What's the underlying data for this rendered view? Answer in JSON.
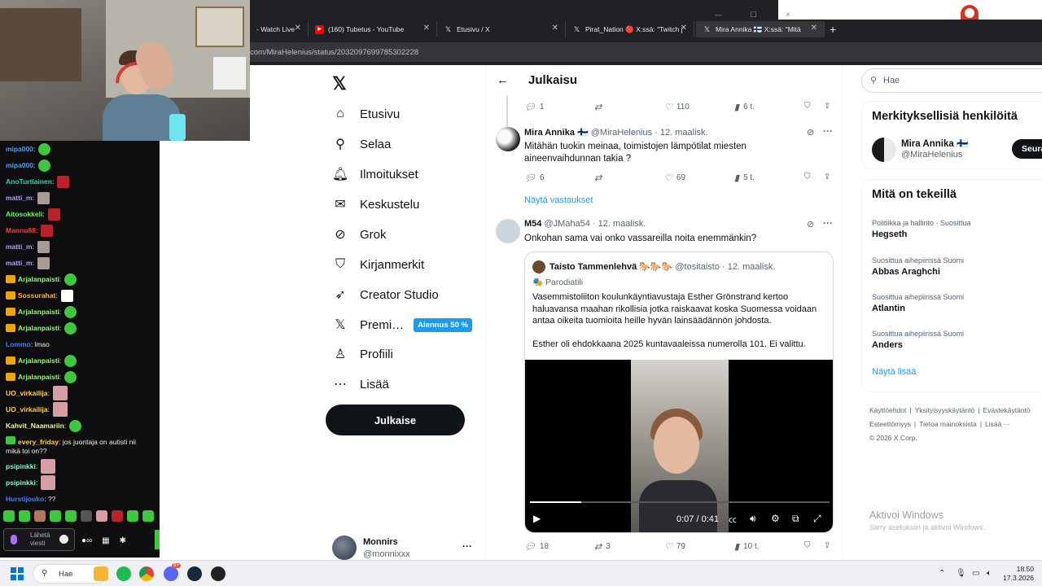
{
  "browser": {
    "tabs": [
      {
        "label": "- Watch Live",
        "active": false
      },
      {
        "label": "(160) Tubetus - YouTube",
        "active": false
      },
      {
        "label": "Etusivu / X",
        "active": false
      },
      {
        "label": "Pirat_Nation 🔴 X:ssä: \"Twitch j",
        "active": false
      },
      {
        "label": "Mira Annika 🇫🇮 X:ssä: \"Mitä",
        "active": true
      }
    ],
    "url": "com/MiraHelenius/status/2032097699785302228"
  },
  "chat": {
    "messages": [
      {
        "user": "mipa000",
        "color": "#4a9eff",
        "body": ":",
        "emote": "green",
        "crown": false
      },
      {
        "user": "mipa000",
        "color": "#4a9eff",
        "body": ":",
        "emote": "green",
        "crown": false
      },
      {
        "user": "AnoTurtiainen",
        "color": "#38d0b5",
        "body": ":",
        "emote": "red",
        "crown": false
      },
      {
        "user": "matti_m",
        "color": "#a7a3ff",
        "body": ":",
        "emote": "cat",
        "crown": false
      },
      {
        "user": "Aitosokkeli",
        "color": "#5cff5c",
        "body": ":",
        "emote": "red",
        "crown": false
      },
      {
        "user": "Mannu88",
        "color": "#ff3b3b",
        "body": ":",
        "emote": "red",
        "crown": false
      },
      {
        "user": "matti_m",
        "color": "#a7a3ff",
        "body": ":",
        "emote": "cat",
        "crown": false
      },
      {
        "user": "matti_m",
        "color": "#a7a3ff",
        "body": ":",
        "emote": "cat",
        "crown": false
      },
      {
        "user": "Arjalanpaisti",
        "color": "#8fff6b",
        "body": ":",
        "emote": "green",
        "crown": true
      },
      {
        "user": "Sossurahat",
        "color": "#ffb347",
        "body": ":",
        "emote": "mute",
        "crown": true
      },
      {
        "user": "Arjalanpaisti",
        "color": "#8fff6b",
        "body": ":",
        "emote": "green",
        "crown": true
      },
      {
        "user": "Arjalanpaisti",
        "color": "#8fff6b",
        "body": ":",
        "emote": "green",
        "crown": true
      },
      {
        "user": "Lommo",
        "color": "#4a7bff",
        "body": ": lmao",
        "emote": "",
        "crown": false
      },
      {
        "user": "Arjalanpaisti",
        "color": "#8fff6b",
        "body": ":",
        "emote": "green",
        "crown": true
      },
      {
        "user": "Arjalanpaisti",
        "color": "#8fff6b",
        "body": ":",
        "emote": "green",
        "crown": true
      },
      {
        "user": "UO_virkailija",
        "color": "#ffd24a",
        "body": ":",
        "emote": "pink",
        "crown": false
      },
      {
        "user": "UO_virkailija",
        "color": "#ffd24a",
        "body": ":",
        "emote": "pink",
        "crown": false
      },
      {
        "user": "Kahvit_Naamariin",
        "color": "#e8f7a0",
        "body": ":",
        "emote": "green",
        "crown": false
      }
    ],
    "long_message": {
      "user": "every_friday",
      "color": "#ffd24a",
      "line1": ": jos juontaja on autisti nii",
      "line2": "mikä toi on??"
    },
    "after": [
      {
        "user": "psipinkki",
        "color": "#7bffcf",
        "body": ":",
        "emote": "pink"
      },
      {
        "user": "psipinkki",
        "color": "#7bffcf",
        "body": ":",
        "emote": "pink"
      },
      {
        "user": "Hurstijouko",
        "color": "#4a7bff",
        "body": ": ??",
        "emote": ""
      }
    ],
    "input_placeholder_1": "Lähetä",
    "input_placeholder_2": "viesti"
  },
  "x": {
    "logo": "𝕏",
    "nav": [
      {
        "label": "Etusivu",
        "icon": "home-icon",
        "glyph": "⌂"
      },
      {
        "label": "Selaa",
        "icon": "search-icon",
        "glyph": "⚲"
      },
      {
        "label": "Ilmoitukset",
        "icon": "bell-icon",
        "glyph": "🔔︎"
      },
      {
        "label": "Keskustelu",
        "icon": "mail-icon",
        "glyph": "✉"
      },
      {
        "label": "Grok",
        "icon": "grok-icon",
        "glyph": "⊘"
      },
      {
        "label": "Kirjanmerkit",
        "icon": "bookmark-icon",
        "glyph": "⛉"
      },
      {
        "label": "Creator Studio",
        "icon": "rocket-icon",
        "glyph": "➶"
      },
      {
        "label": "Premi…",
        "icon": "x-premium-icon",
        "glyph": "𝕏"
      },
      {
        "label": "Profiili",
        "icon": "profile-icon",
        "glyph": "♙"
      },
      {
        "label": "Lisää",
        "icon": "more-icon",
        "glyph": "⋯"
      }
    ],
    "premium_badge": "Alennus 50 %",
    "post_button": "Julkaise",
    "account": {
      "name": "Monnirs",
      "handle": "@monnixxx",
      "more": "···"
    },
    "main_title": "Julkaisu",
    "top_actions": {
      "replies": "1",
      "reposts": "",
      "likes": "110",
      "views": "6 t."
    },
    "reply1": {
      "name": "Mira Annika 🇫🇮",
      "meta": "@MiraHelenius · 12. maalisk.",
      "text": "Mitähän tuokin meinaa, toimistojen lämpötilat miesten aineenvaihdunnan takia ?",
      "replies": "6",
      "likes": "69",
      "views": "5 t."
    },
    "show_replies": "Näytä vastaukset",
    "reply2": {
      "name": "M54",
      "meta": "@JMaha54 · 12. maalisk.",
      "text": "Onkohan sama vai onko vassareilla noita enemmänkin?",
      "replies": "18",
      "reposts": "3",
      "likes": "79",
      "views": "10 t."
    },
    "quote": {
      "name": "Taisto Tammenlehvä 🐎🐎🐎",
      "meta": "@tositaisto · 12. maalisk.",
      "parody": "🎭 Parodiatili",
      "text1": "Vasemmistoliiton koulunkäyntiavustaja Esther Grönstrand kertoo haluavansa maahan rikollisia jotka raiskaavat koska Suomessa voidaan antaa oikeita tuomioita heille hyvän lainsäädännön johdosta.",
      "text2": "Esther oli ehdokkaana 2025 kuntavaaleissa numerolla 101. Ei valittu.",
      "video_time": "0:07 / 0:41",
      "video_progress": 0.17
    },
    "right": {
      "search_placeholder": "Hae",
      "relevant_title": "Merkityksellisiä henkilöitä",
      "relevant_name": "Mira Annika 🇫🇮",
      "relevant_handle": "@MiraHelenius",
      "follow": "Seura",
      "trends_title": "Mitä on tekeillä",
      "trends": [
        {
          "context": "Politiikka ja hallinto · Suosittua",
          "name": "Hegseth"
        },
        {
          "context": "Suosittua aihepiirissä Suomi",
          "name": "Abbas Araghchi"
        },
        {
          "context": "Suosittua aihepiirissä Suomi",
          "name": "Atlantin"
        },
        {
          "context": "Suosittua aihepiirissä Suomi",
          "name": "Anders"
        }
      ],
      "show_more": "Näytä lisää",
      "footer": [
        "Käyttöehdot",
        "|",
        "Yksityisyyskäytäntö",
        "|",
        "Evästekäytäntö",
        "Esteettömyys",
        "|",
        "Tietoa mainoksista",
        "|",
        "Lisää ···",
        "© 2026 X Corp."
      ],
      "activate_title": "Aktivoi Windows",
      "activate_sub": "Siirry asetuksiin ja aktivoi Windows."
    }
  },
  "taskbar": {
    "search": "Hae",
    "time": "18.50",
    "date": "17.3.2026",
    "discord_badge": "9+"
  }
}
